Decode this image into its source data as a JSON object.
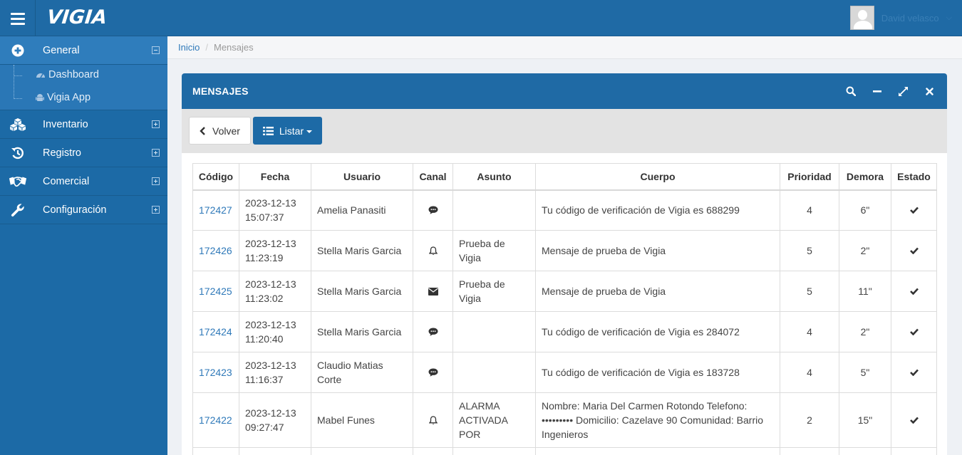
{
  "app": {
    "name": "VIGIA",
    "user": "David velasco"
  },
  "sidebar": {
    "items": [
      {
        "label": "General",
        "icon": "plus-circle-icon",
        "expanded": true
      },
      {
        "label": "Inventario",
        "icon": "cubes-icon"
      },
      {
        "label": "Registro",
        "icon": "history-icon"
      },
      {
        "label": "Comercial",
        "icon": "handshake-icon"
      },
      {
        "label": "Configuración",
        "icon": "wrench-icon"
      }
    ],
    "submenu": [
      {
        "label": "Dashboard",
        "icon": "dashboard-icon"
      },
      {
        "label": "Vigia App",
        "icon": "android-icon"
      }
    ]
  },
  "breadcrumb": {
    "home": "Inicio",
    "sep": "/",
    "current": "Mensajes"
  },
  "panel": {
    "title": "MENSAJES",
    "back_label": "Volver",
    "list_label": "Listar"
  },
  "table": {
    "headers": [
      "Código",
      "Fecha",
      "Usuario",
      "Canal",
      "Asunto",
      "Cuerpo",
      "Prioridad",
      "Demora",
      "Estado"
    ],
    "rows": [
      {
        "codigo": "172427",
        "fecha1": "2023-12-13",
        "fecha2": "15:07:37",
        "usuario": "Amelia Panasiti",
        "canal": "sms-icon",
        "asunto": "",
        "cuerpo": "Tu código de verificación de Vigia es 688299",
        "prioridad": "4",
        "demora": "6\"",
        "estado": "check-icon"
      },
      {
        "codigo": "172426",
        "fecha1": "2023-12-13",
        "fecha2": "11:23:19",
        "usuario": "Stella Maris Garcia",
        "canal": "bell-icon",
        "asunto": "Prueba de Vigia",
        "cuerpo": "Mensaje de prueba de Vigia",
        "prioridad": "5",
        "demora": "2\"",
        "estado": "check-icon"
      },
      {
        "codigo": "172425",
        "fecha1": "2023-12-13",
        "fecha2": "11:23:02",
        "usuario": "Stella Maris Garcia",
        "canal": "envelope-icon",
        "asunto": "Prueba de Vigia",
        "cuerpo": "Mensaje de prueba de Vigia",
        "prioridad": "5",
        "demora": "11\"",
        "estado": "check-icon"
      },
      {
        "codigo": "172424",
        "fecha1": "2023-12-13",
        "fecha2": "11:20:40",
        "usuario": "Stella Maris Garcia",
        "canal": "sms-icon",
        "asunto": "",
        "cuerpo": "Tu código de verificación de Vigia es 284072",
        "prioridad": "4",
        "demora": "2\"",
        "estado": "check-icon"
      },
      {
        "codigo": "172423",
        "fecha1": "2023-12-13",
        "fecha2": "11:16:37",
        "usuario": "Claudio Matias Corte",
        "canal": "sms-icon",
        "asunto": "",
        "cuerpo": "Tu código de verificación de Vigia es 183728",
        "prioridad": "4",
        "demora": "5\"",
        "estado": "check-icon"
      },
      {
        "codigo": "172422",
        "fecha1": "2023-12-13",
        "fecha2": "09:27:47",
        "usuario": "Mabel Funes",
        "canal": "bell-icon",
        "asunto": "ALARMA ACTIVADA POR",
        "cuerpo": "Nombre: Maria Del Carmen Rotondo Telefono: ••••••••• Domicilio: Cazelave 90 Comunidad: Barrio Ingenieros",
        "prioridad": "2",
        "demora": "15\"",
        "estado": "check-icon"
      }
    ]
  }
}
